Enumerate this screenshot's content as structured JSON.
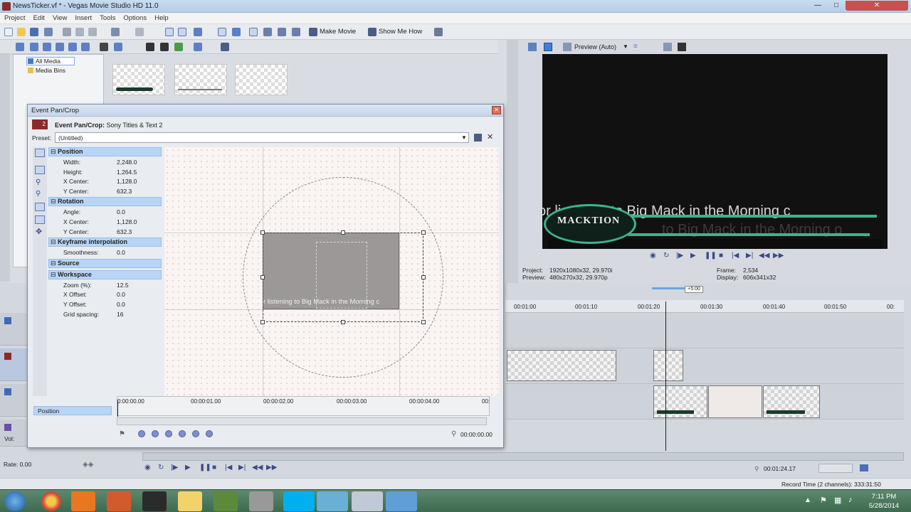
{
  "window": {
    "title": "NewsTicker.vf * - Vegas Movie Studio HD 11.0",
    "controls": [
      "—",
      "□",
      "✕"
    ]
  },
  "menu": [
    "Project",
    "Edit",
    "View",
    "Insert",
    "Tools",
    "Options",
    "Help"
  ],
  "toolbar": {
    "make_movie": "Make Movie",
    "show_me_how": "Show Me How"
  },
  "explorer": {
    "tree": [
      "All Media",
      "Media Bins"
    ]
  },
  "preview": {
    "mode": "Preview (Auto)",
    "ticker_text_1": "or listening to Big Mack in the Morning c",
    "ticker_text_2": "to Big Mack in the Morning o",
    "logo_text": "MACKTION",
    "project_label": "Project:",
    "project_value": "1920x1080x32, 29.970i",
    "preview_label": "Preview:",
    "preview_value": "480x270x32, 29.970p",
    "frame_label": "Frame:",
    "frame_value": "2,534",
    "display_label": "Display:",
    "display_value": "606x341x32"
  },
  "dialog": {
    "title": "Event Pan/Crop",
    "badge": "2",
    "subtitle_bold": "Event Pan/Crop:",
    "subtitle_rest": " Sony Titles & Text 2",
    "preset_label": "Preset:",
    "preset_value": "(Untitled)",
    "canvas_text": "r listening to Big Mack in the Morning c",
    "sections": [
      {
        "name": "Position",
        "rows": [
          {
            "k": "Width:",
            "v": "2,248.0"
          },
          {
            "k": "Height:",
            "v": "1,264.5"
          },
          {
            "k": "X Center:",
            "v": "1,128.0"
          },
          {
            "k": "Y Center:",
            "v": "632.3"
          }
        ]
      },
      {
        "name": "Rotation",
        "rows": [
          {
            "k": "Angle:",
            "v": "0.0"
          },
          {
            "k": "X Center:",
            "v": "1,128.0"
          },
          {
            "k": "Y Center:",
            "v": "632.3"
          }
        ]
      },
      {
        "name": "Keyframe interpolation",
        "rows": [
          {
            "k": "Smoothness:",
            "v": "0.0"
          }
        ]
      },
      {
        "name": "Source",
        "rows": []
      },
      {
        "name": "Workspace",
        "rows": [
          {
            "k": "Zoom (%):",
            "v": "12.5"
          },
          {
            "k": "X Offset:",
            "v": "0.0"
          },
          {
            "k": "Y Offset:",
            "v": "0.0"
          },
          {
            "k": "Grid spacing:",
            "v": "16"
          }
        ]
      }
    ],
    "timeline_track": "Position",
    "ruler": [
      "0:00:00.00",
      "00:00:01.00",
      "00:00:02.00",
      "00:00:03.00",
      "00:00:04.00",
      "00:"
    ],
    "timecode": "00:00:00.00"
  },
  "timeline": {
    "ruler": [
      "00:01:00",
      "00:01:10",
      "00:01:20",
      "00:01:30",
      "00:01:40",
      "00:01:50",
      "00:"
    ],
    "cursor_badge": "+5:00",
    "vol_label": "Vol:",
    "rate": "Rate: 0.00",
    "cursor_time": "00:01:24.17",
    "record_time": "Record Time (2 channels): 333:31:50"
  },
  "taskbar": {
    "time": "7:11 PM",
    "date": "5/28/2014"
  },
  "colors": {
    "selection": "#b9d5f5",
    "titlebar": "#c9dcf0",
    "taskbar": "#4a7a5c",
    "ticker_green": "#3bb38e"
  }
}
